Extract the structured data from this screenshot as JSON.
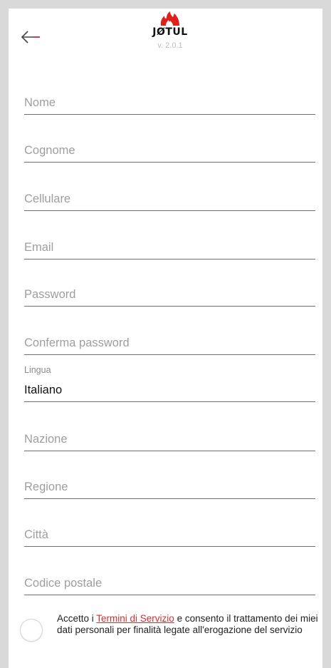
{
  "header": {
    "logo_text": "JØTUL",
    "version": "v. 2.0.1"
  },
  "form": {
    "nome_placeholder": "Nome",
    "cognome_placeholder": "Cognome",
    "cellulare_placeholder": "Cellulare",
    "email_placeholder": "Email",
    "password_placeholder": "Password",
    "conferma_password_placeholder": "Conferma password",
    "lingua_label": "Lingua",
    "lingua_value": "Italiano",
    "nazione_placeholder": "Nazione",
    "regione_placeholder": "Regione",
    "citta_placeholder": "Città",
    "codice_postale_placeholder": "Codice postale"
  },
  "terms": {
    "prefix": "Accetto i ",
    "link": "Termini di Servizio",
    "suffix": " e consento il trattamento dei miei dati personali per finalità legate all'erogazione del servizio"
  },
  "colors": {
    "accent": "#d32f2f",
    "logo_flame": "#e0201b",
    "background": "#d9d9d9"
  }
}
